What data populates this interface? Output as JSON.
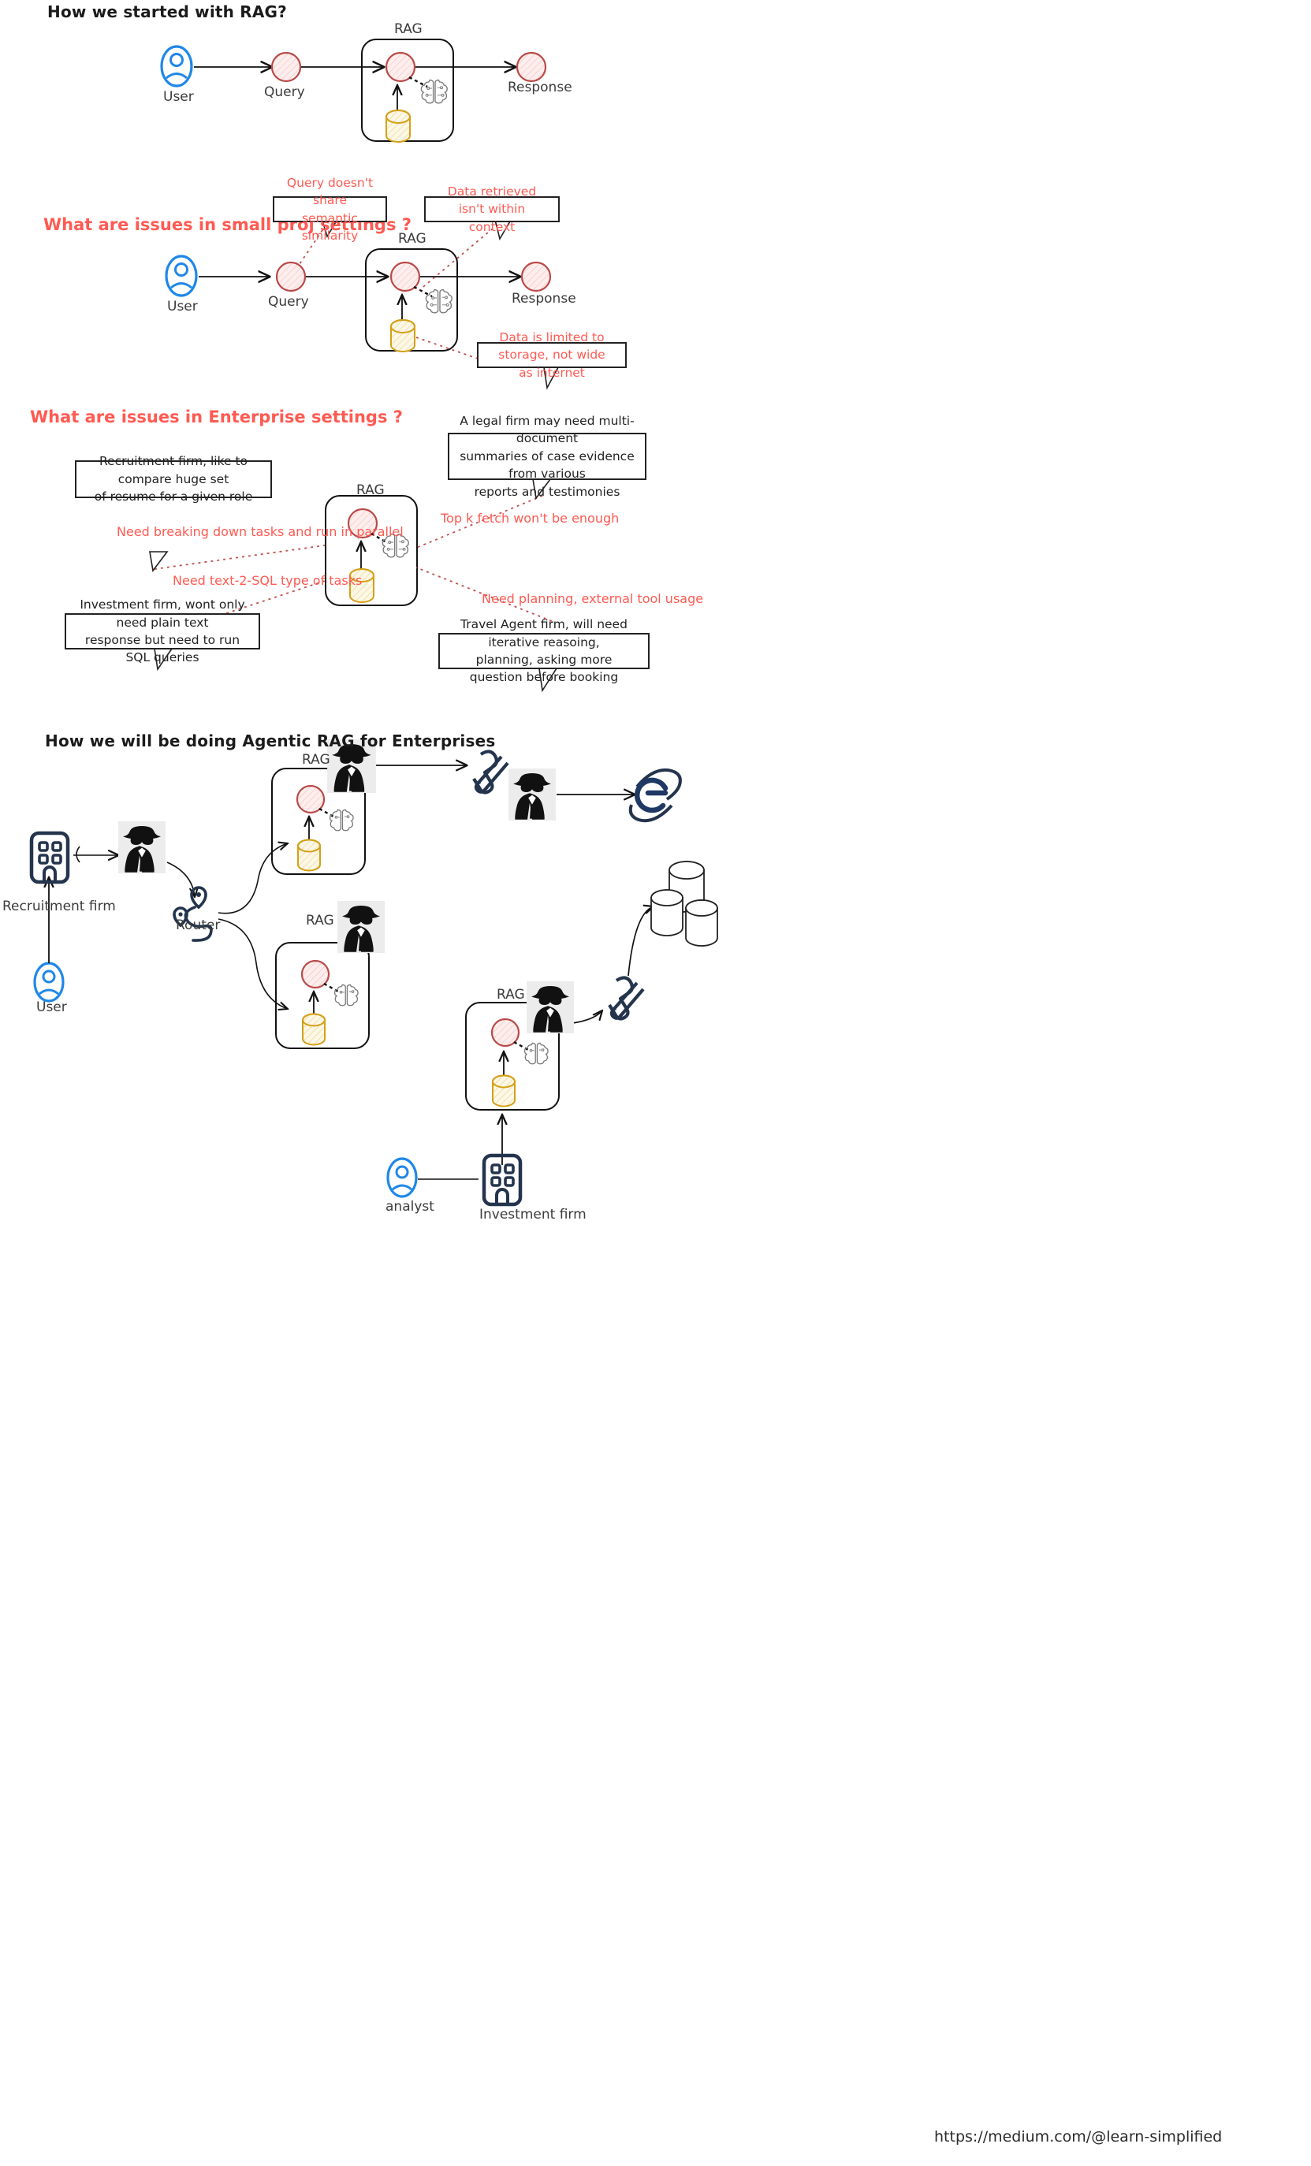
{
  "page": {
    "footer_url": "https://medium.com/@learn-simplified",
    "colors": {
      "accent_red": "#ff5a52",
      "node_red_stroke": "#b94a48",
      "node_red_fill": "#fdeceb",
      "db_yellow": "#d4a017",
      "user_blue": "#1f87e8",
      "icon_navy": "#24344d",
      "brain_gray": "#7a7a7a",
      "text_dark": "#1f1f1f",
      "agent_bg": "#ececec"
    }
  },
  "sections": [
    {
      "id": "started",
      "title": "How we started with RAG?",
      "nodes": {
        "user": "User",
        "query": "Query",
        "rag": "RAG",
        "response": "Response"
      },
      "icons": [
        "user-icon",
        "query-node",
        "rag-container",
        "brain-chip-icon",
        "database-cylinder-icon",
        "response-node"
      ]
    },
    {
      "id": "small-proj",
      "title": "What are issues in small proj settings ?",
      "nodes": {
        "user": "User",
        "query": "Query",
        "rag": "RAG",
        "response": "Response"
      },
      "callouts": [
        {
          "id": "semantic",
          "lines": [
            "Query doesn't share",
            "semantic similarity"
          ]
        },
        {
          "id": "context",
          "lines": [
            "Data retrieved isn't within",
            "context"
          ]
        },
        {
          "id": "storage",
          "lines": [
            "Data is limited to storage, not wide",
            "as internet"
          ]
        }
      ]
    },
    {
      "id": "enterprise",
      "title": "What are issues in Enterprise settings ?",
      "nodes": {
        "rag": "RAG"
      },
      "callouts": [
        {
          "id": "recruitment",
          "lines": [
            "Recruitment firm, like to compare huge set",
            "of resume for a given role"
          ]
        },
        {
          "id": "legal",
          "lines": [
            "A legal firm may need multi-document",
            "summaries of case evidence from various",
            "reports and testimonies"
          ]
        },
        {
          "id": "investment",
          "lines": [
            "Investment firm, wont only need plain text",
            "response but need to run SQL queries"
          ]
        },
        {
          "id": "travel",
          "lines": [
            "Travel Agent firm, will need iterative reasoing,",
            "planning, asking more question before booking"
          ]
        }
      ],
      "annotations": [
        {
          "id": "parallel",
          "text": "Need breaking down tasks and run in parallel"
        },
        {
          "id": "topk",
          "text": "Top k fetch won't be enough"
        },
        {
          "id": "text2sql",
          "text": "Need text-2-SQL type of tasks"
        },
        {
          "id": "planning",
          "text": "Need planning, external tool usage"
        }
      ]
    },
    {
      "id": "agentic",
      "title": "How we will be doing Agentic RAG for Enterprises",
      "nodes": {
        "recruitment_firm": "Recruitment firm",
        "user": "User",
        "router": "Router",
        "rag1": "RAG",
        "rag2": "RAG",
        "rag3": "RAG",
        "analyst": "analyst",
        "investment_firm": "Investment firm"
      },
      "icons": [
        "building-icon",
        "agent-detective-icon",
        "router-pin-icon",
        "rag-container",
        "tools-wrench-screwdriver-icon",
        "internet-explorer-icon",
        "database-stack-icon",
        "user-icon",
        "brain-chip-icon",
        "database-cylinder-icon"
      ]
    }
  ]
}
